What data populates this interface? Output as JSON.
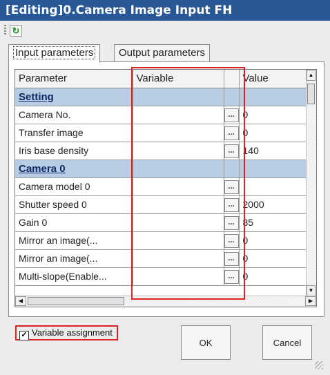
{
  "window": {
    "title": "[Editing]0.Camera Image Input FH"
  },
  "toolbar": {
    "refresh_icon": "refresh-icon"
  },
  "tabs": [
    {
      "label": "Input parameters",
      "active": true
    },
    {
      "label": "Output parameters",
      "active": false
    }
  ],
  "grid": {
    "headers": {
      "parameter": "Parameter",
      "variable": "Variable",
      "value": "Value"
    },
    "rows": [
      {
        "kind": "section",
        "parameter": "Setting",
        "variable": "",
        "value": ""
      },
      {
        "kind": "param",
        "parameter": "Camera No.",
        "variable": "",
        "button": "...",
        "value": "0"
      },
      {
        "kind": "param",
        "parameter": "Transfer image",
        "variable": "",
        "button": "...",
        "value": "0"
      },
      {
        "kind": "param",
        "parameter": "Iris base density",
        "variable": "",
        "button": "...",
        "value": "140"
      },
      {
        "kind": "section",
        "parameter": "Camera 0",
        "variable": "",
        "value": ""
      },
      {
        "kind": "param",
        "parameter": "Camera model 0",
        "variable": "",
        "button": "...",
        "value": ""
      },
      {
        "kind": "param",
        "parameter": "Shutter speed 0",
        "variable": "",
        "button": "...",
        "value": "2000"
      },
      {
        "kind": "param",
        "parameter": "Gain 0",
        "variable": "",
        "button": "...",
        "value": "85"
      },
      {
        "kind": "param",
        "parameter": "Mirror an image(...",
        "variable": "",
        "button": "...",
        "value": "0"
      },
      {
        "kind": "param",
        "parameter": "Mirror an image(...",
        "variable": "",
        "button": "...",
        "value": "0"
      },
      {
        "kind": "param",
        "parameter": "Multi-slope(Enable...",
        "variable": "",
        "button": "...",
        "value": "0"
      }
    ]
  },
  "footer": {
    "variable_assignment_label": "Variable assignment",
    "variable_assignment_checked": true,
    "ok_label": "OK",
    "cancel_label": "Cancel"
  },
  "colors": {
    "titlebar": "#2a5796",
    "section_row": "#b8cde3",
    "highlight_box": "#dd2222"
  }
}
